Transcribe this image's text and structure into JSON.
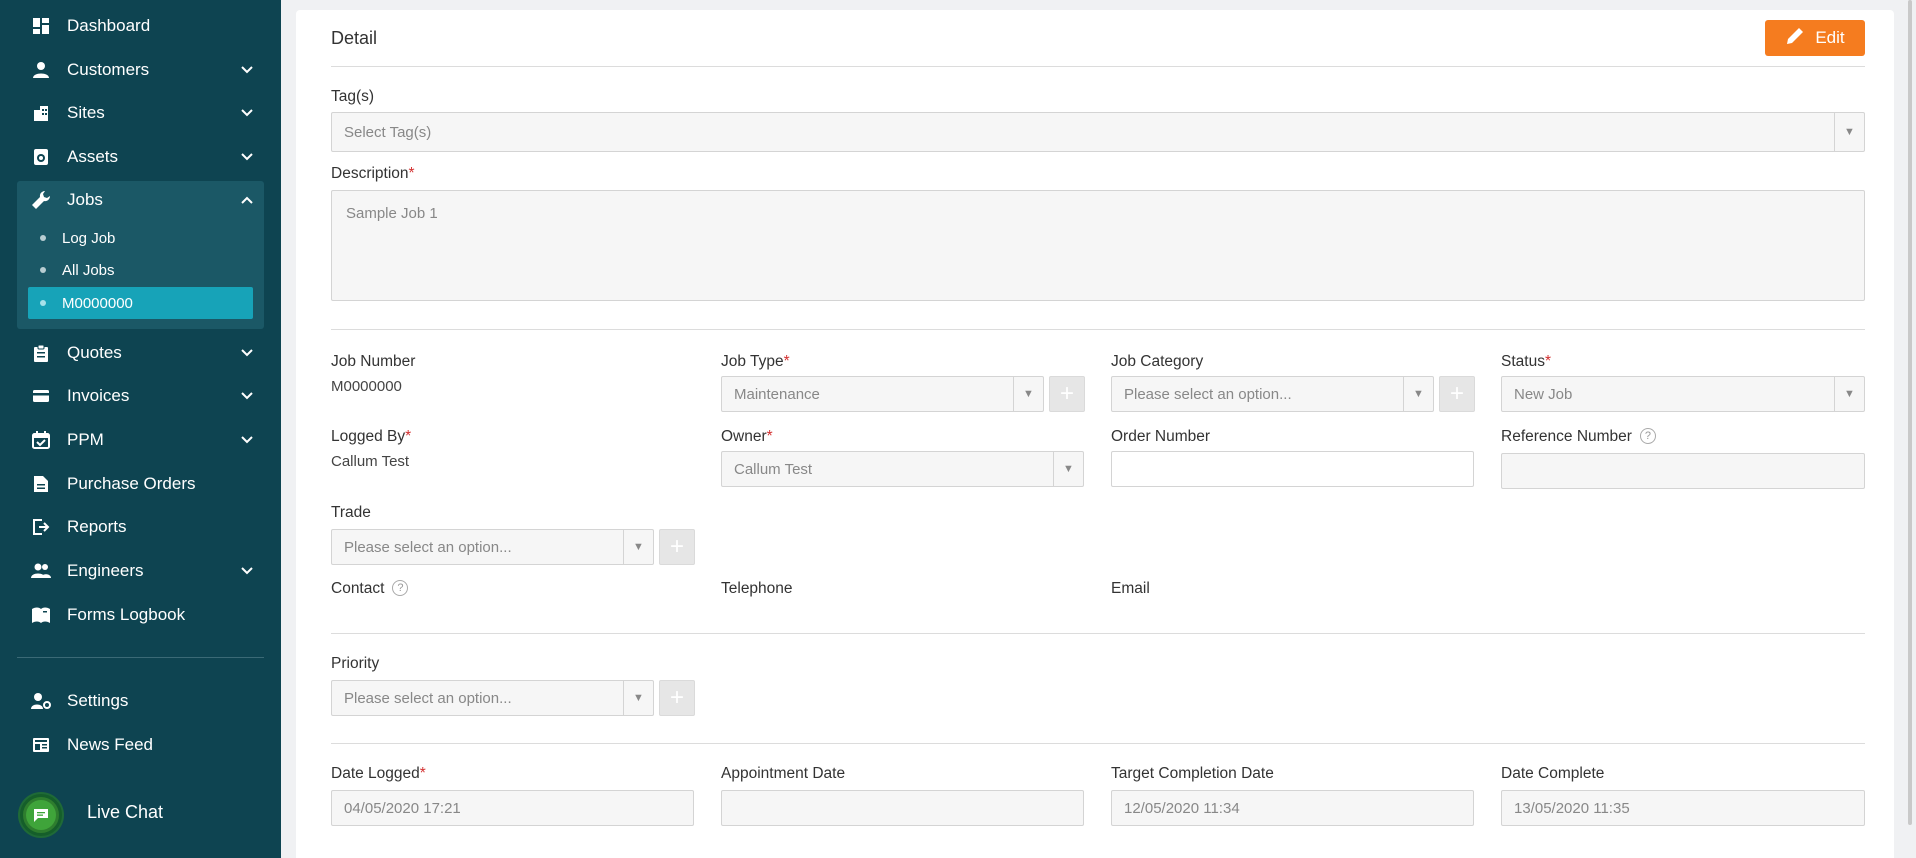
{
  "sidebar": {
    "items": [
      {
        "label": "Dashboard",
        "icon": "dashboard-icon"
      },
      {
        "label": "Customers",
        "icon": "person-icon"
      },
      {
        "label": "Sites",
        "icon": "building-icon"
      },
      {
        "label": "Assets",
        "icon": "asset-icon"
      },
      {
        "label": "Jobs",
        "icon": "wrench-icon"
      },
      {
        "label": "Quotes",
        "icon": "clipboard-icon"
      },
      {
        "label": "Invoices",
        "icon": "invoice-icon"
      },
      {
        "label": "PPM",
        "icon": "calendar-check-icon"
      },
      {
        "label": "Purchase Orders",
        "icon": "document-icon"
      },
      {
        "label": "Reports",
        "icon": "export-icon"
      },
      {
        "label": "Engineers",
        "icon": "people-icon"
      },
      {
        "label": "Forms Logbook",
        "icon": "book-icon"
      },
      {
        "label": "Settings",
        "icon": "user-gear-icon"
      },
      {
        "label": "News Feed",
        "icon": "newspaper-icon"
      }
    ],
    "jobs_sub": [
      {
        "label": "Log Job"
      },
      {
        "label": "All Jobs"
      },
      {
        "label": "M0000000"
      }
    ],
    "live_chat": "Live Chat"
  },
  "detail": {
    "title": "Detail",
    "edit_label": "Edit",
    "accent": "#f57c1f",
    "tags": {
      "label": "Tag(s)",
      "placeholder": "Select Tag(s)"
    },
    "description": {
      "label": "Description",
      "required": "*",
      "value": "Sample Job 1"
    },
    "job_number": {
      "label": "Job Number",
      "value": "M0000000"
    },
    "job_type": {
      "label": "Job Type",
      "required": "*",
      "value": "Maintenance"
    },
    "job_category": {
      "label": "Job Category",
      "value": "Please select an option..."
    },
    "status": {
      "label": "Status",
      "required": "*",
      "value": "New Job"
    },
    "logged_by": {
      "label": "Logged By",
      "required": "*",
      "value": "Callum Test"
    },
    "owner": {
      "label": "Owner",
      "required": "*",
      "value": "Callum Test"
    },
    "order_number": {
      "label": "Order Number",
      "value": ""
    },
    "reference_number": {
      "label": "Reference Number",
      "value": ""
    },
    "trade": {
      "label": "Trade",
      "value": "Please select an option..."
    },
    "contact": {
      "label": "Contact"
    },
    "telephone": {
      "label": "Telephone"
    },
    "email": {
      "label": "Email"
    },
    "priority": {
      "label": "Priority",
      "value": "Please select an option..."
    },
    "date_logged": {
      "label": "Date Logged",
      "required": "*",
      "value": "04/05/2020 17:21"
    },
    "appointment_date": {
      "label": "Appointment Date",
      "value": ""
    },
    "target_completion_date": {
      "label": "Target Completion Date",
      "value": "12/05/2020 11:34"
    },
    "date_complete": {
      "label": "Date Complete",
      "value": "13/05/2020 11:35"
    },
    "help_glyph": "?",
    "plus_glyph": "+",
    "caret_glyph": "▼"
  }
}
